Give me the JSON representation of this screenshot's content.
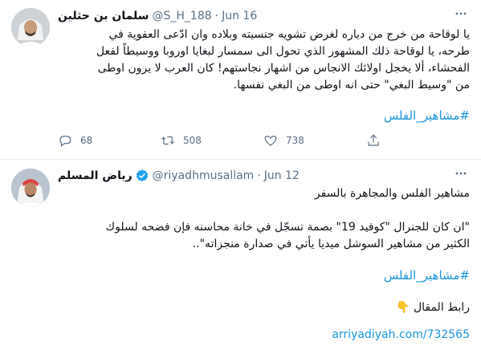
{
  "tweet1": {
    "name": "سلمان بن حثلين",
    "handle": "@S_H_188",
    "dot": "·",
    "date": "Jun 16",
    "lines": [
      "يا لوقاحة من خرج من دياره لغرض تشويه جنسيته وبلاده وان ادّعى العفوية في",
      "طرحه، يا لوقاحة ذلك المشهور الذي تحول الى سمسار لبغايا اوروبا ووسيطاً لفعل",
      "الفحشاء، ألا يخجل اولائك الانجاس من اشهار نجاستهم! كان العرب لا يرون اوطى",
      "من \"وسيط البغي\" حتى انه اوطى من البغي نفسها."
    ],
    "hashtag": "#مشاهير_الفلس",
    "replies": "68",
    "retweets": "508",
    "likes": "738"
  },
  "tweet2": {
    "name": "رياض المسلم",
    "handle": "@riyadhmusallam",
    "dot": "·",
    "date": "Jun 12",
    "line1": "مشاهير الفلس والمجاهرة بالسفر",
    "line2": "\"ان كان للجنرال \"كوفيد 19\" بصمة تسجّل في خانة محاسنه فإن فضحه لسلوك",
    "line3": "الكثير من مشاهير السوشل ميديا يأتي في صدارة منجزاته\"..",
    "hashtag": "#مشاهير_الفلس",
    "link_label": "رابط المقال",
    "emoji": "👇",
    "url": "arriyadiyah.com/732565"
  },
  "icons": {
    "more": "more-options-icon",
    "reply": "reply-icon",
    "retweet": "retweet-icon",
    "like": "heart-icon",
    "share": "share-icon",
    "verified": "verified-badge-icon"
  },
  "colors": {
    "link": "#1b95e0",
    "muted": "#5b7083",
    "text": "#0f1419",
    "verified": "#1da1f2",
    "divider": "#e6ecf0"
  }
}
